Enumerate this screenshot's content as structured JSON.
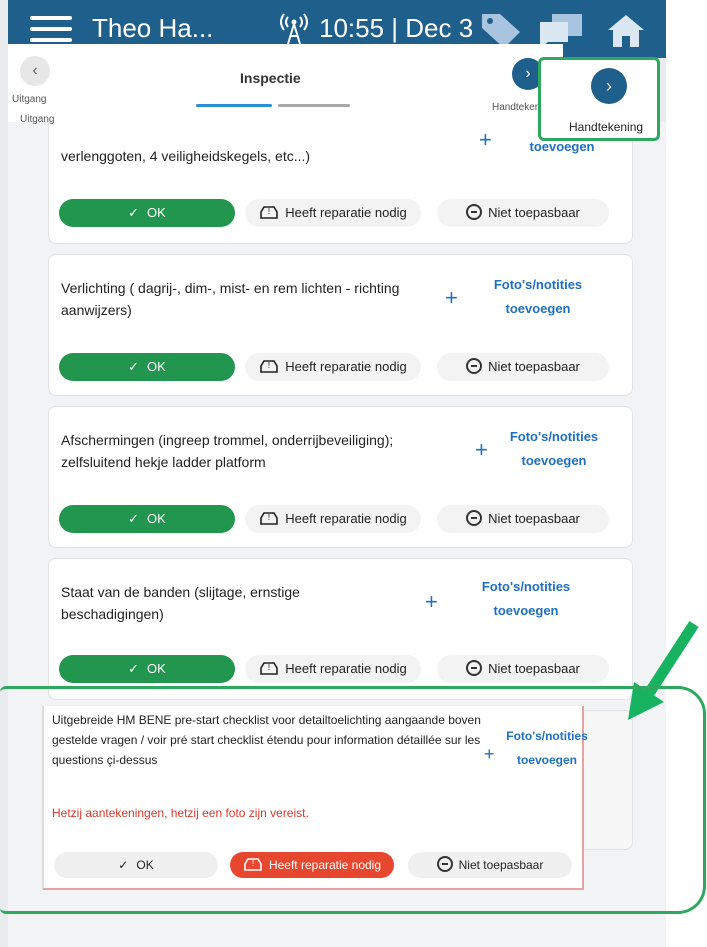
{
  "colors": {
    "appbar": "#1f5f8b",
    "ok_green": "#22954f",
    "link_blue": "#1f70c1",
    "highlight_green": "#2fa85f",
    "repair_red": "#e8472f",
    "warning_red": "#d9392b"
  },
  "appbar": {
    "title": "Theo Ha...",
    "clock": "10:55 | Dec 3",
    "icons": [
      "menu-icon",
      "signal-icon",
      "tag-icon",
      "chat-icon",
      "home-icon"
    ]
  },
  "header": {
    "back_label": "Uitgang",
    "back_label_shadow": "Uitgang",
    "title": "Inspectie",
    "next_label": "Handtekening",
    "progress_steps": 2,
    "progress_current": 1
  },
  "zoom": {
    "next_label": "Handtekening"
  },
  "cards": [
    {
      "text": "verlenggoten, 4 veiligheidskegels, etc...)",
      "photo_line1": "",
      "photo_line2": "toevoegen",
      "ok": "OK",
      "repair": "Heeft reparatie nodig",
      "na": "Niet toepasbaar"
    },
    {
      "text": "Verlichting ( dagrij-, dim-, mist- en rem lichten - richting aanwijzers)",
      "photo_line1": "Foto's/notities",
      "photo_line2": "toevoegen",
      "ok": "OK",
      "repair": "Heeft reparatie nodig",
      "na": "Niet toepasbaar"
    },
    {
      "text": "Afschermingen (ingreep trommel, onderrijbeveiliging); zelfsluitend hekje ladder platform",
      "photo_line1": "Foto's/notities",
      "photo_line2": "toevoegen",
      "ok": "OK",
      "repair": "Heeft reparatie nodig",
      "na": "Niet toepasbaar"
    },
    {
      "text": "Staat van de banden (slijtage, ernstige beschadigingen)",
      "photo_line1": "Foto's/notities",
      "photo_line2": "toevoegen",
      "ok": "OK",
      "repair": "Heeft reparatie nodig",
      "na": "Niet toepasbaar"
    }
  ],
  "focus_card": {
    "text": "Uitgebreide HM BENE pre-start checklist voor detailtoelichting aangaande boven gestelde vragen / voir pré start checklist étendu pour information détaillée sur les questions çi-dessus",
    "photo_line1": "Foto's/notities",
    "photo_line2": "toevoegen",
    "warning": "Hetzij aantekeningen, hetzij een foto zijn vereist.",
    "ok": "OK",
    "repair": "Heeft reparatie nodig",
    "na": "Niet toepasbaar"
  }
}
